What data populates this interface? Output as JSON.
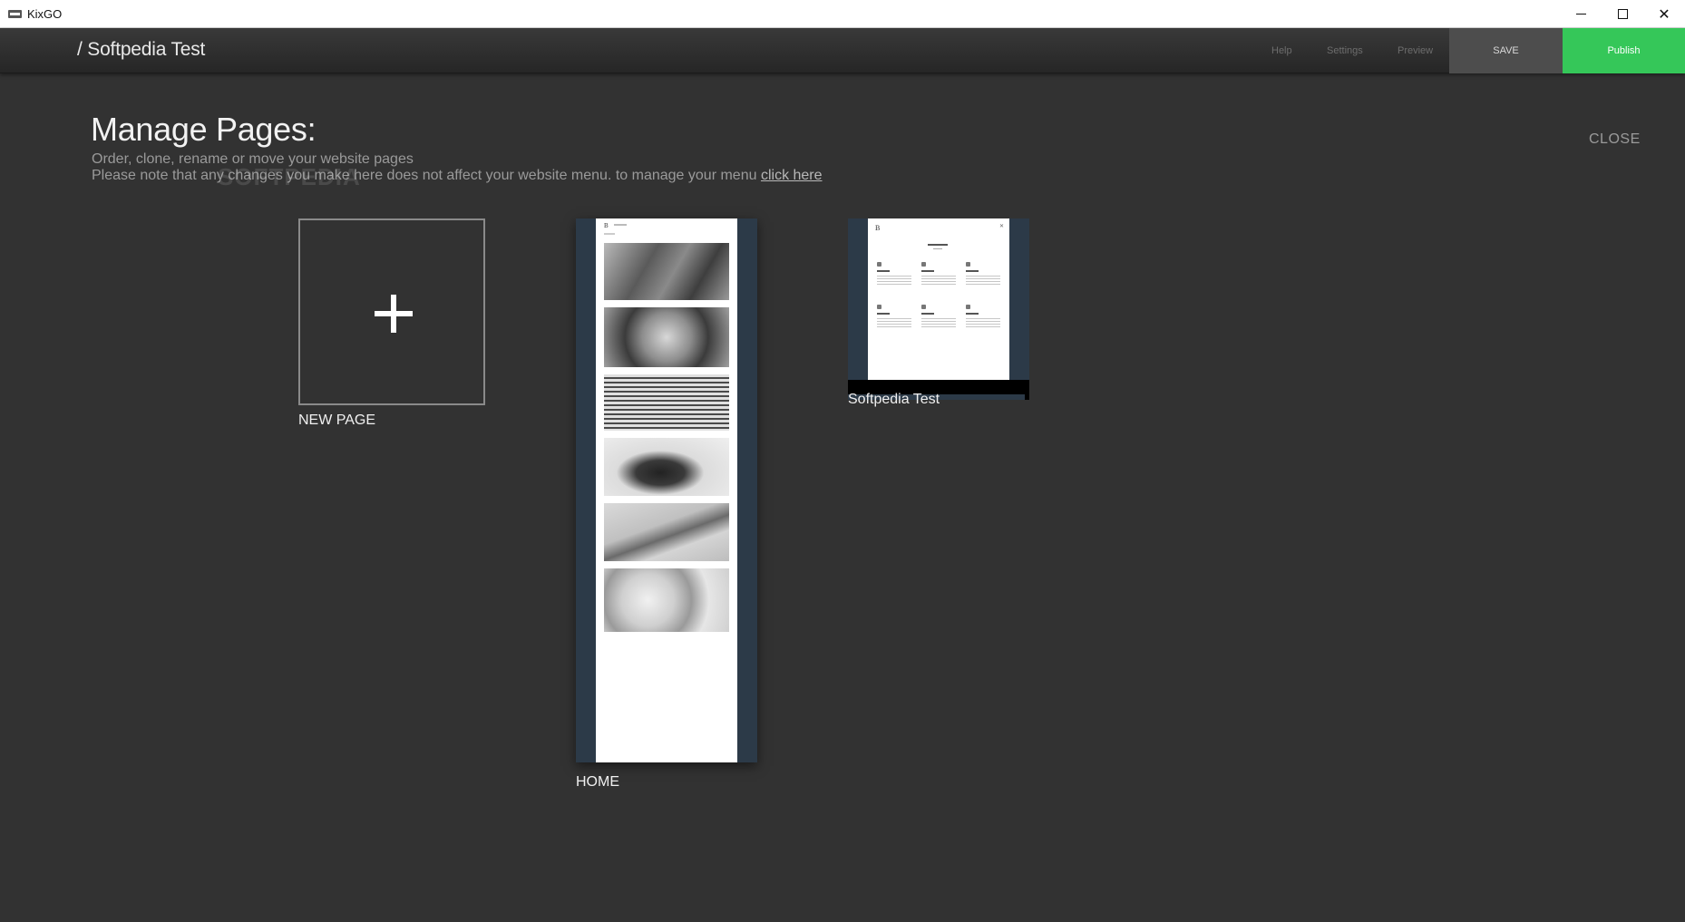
{
  "window": {
    "title": "KixGO"
  },
  "topbar": {
    "site_title": "/ Softpedia Test",
    "nav": {
      "help": "Help",
      "settings": "Settings",
      "preview": "Preview"
    },
    "save_label": "SAVE",
    "publish_label": "Publish",
    "colors": {
      "publish": "#35c759",
      "save": "#4d4d4d"
    }
  },
  "manage": {
    "heading": "Manage Pages:",
    "subtitle": "Order, clone, rename or move your website pages",
    "note": "Please note that any changes you make here does not affect your website menu. to manage your menu",
    "note_link": "click here",
    "close_label": "CLOSE",
    "watermark": "SOFTPEDIA"
  },
  "pages": {
    "new_page_label": "NEW PAGE",
    "new_page_icon": "plus-icon",
    "home_label": "HOME",
    "softpedia_label": "Softpedia Test"
  }
}
